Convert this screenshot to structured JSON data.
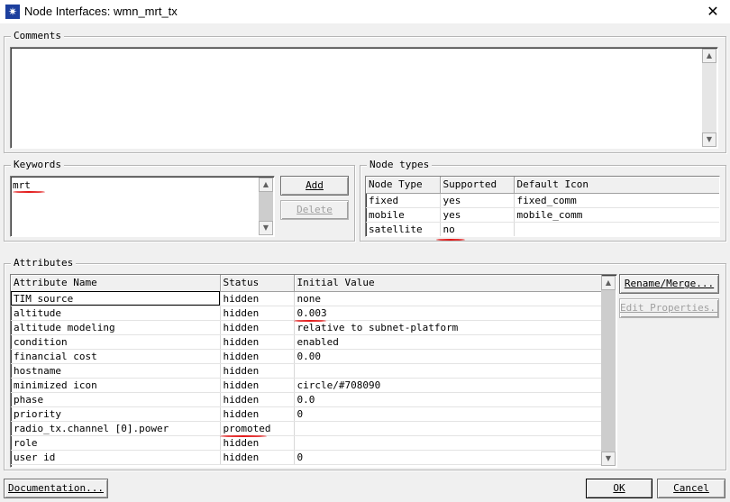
{
  "window": {
    "title": "Node Interfaces: wmn_mrt_tx",
    "close_glyph": "✕"
  },
  "comments": {
    "label": "Comments",
    "value": ""
  },
  "keywords": {
    "label": "Keywords",
    "items": [
      "mrt"
    ],
    "add_label": "Add",
    "delete_label": "Delete"
  },
  "node_types": {
    "label": "Node types",
    "columns": [
      "Node Type",
      "Supported",
      "Default Icon"
    ],
    "rows": [
      [
        "fixed",
        "yes",
        "fixed_comm"
      ],
      [
        "mobile",
        "yes",
        "mobile_comm"
      ],
      [
        "satellite",
        "no",
        ""
      ]
    ]
  },
  "attributes": {
    "label": "Attributes",
    "columns": [
      "Attribute Name",
      "Status",
      "Initial Value"
    ],
    "rows": [
      [
        "TIM source",
        "hidden",
        "none"
      ],
      [
        "altitude",
        "hidden",
        "0.003"
      ],
      [
        "altitude modeling",
        "hidden",
        "relative to subnet-platform"
      ],
      [
        "condition",
        "hidden",
        "enabled"
      ],
      [
        "financial cost",
        "hidden",
        "0.00"
      ],
      [
        "hostname",
        "hidden",
        ""
      ],
      [
        "minimized icon",
        "hidden",
        "circle/#708090"
      ],
      [
        "phase",
        "hidden",
        "0.0"
      ],
      [
        "priority",
        "hidden",
        "0"
      ],
      [
        "radio_tx.channel [0].power",
        "promoted",
        ""
      ],
      [
        "role",
        "hidden",
        ""
      ],
      [
        "user id",
        "hidden",
        "0"
      ]
    ],
    "rename_label": "Rename/Merge...",
    "edit_label": "Edit Properties..."
  },
  "footer": {
    "documentation_label": "Documentation...",
    "ok_label": "OK",
    "cancel_label": "Cancel"
  },
  "colors": {
    "annotation": "#e31a1a",
    "title_icon": "#1c3f9e"
  },
  "icons": [
    "app-icon",
    "close-icon",
    "scroll-up-icon",
    "scroll-down-icon"
  ]
}
